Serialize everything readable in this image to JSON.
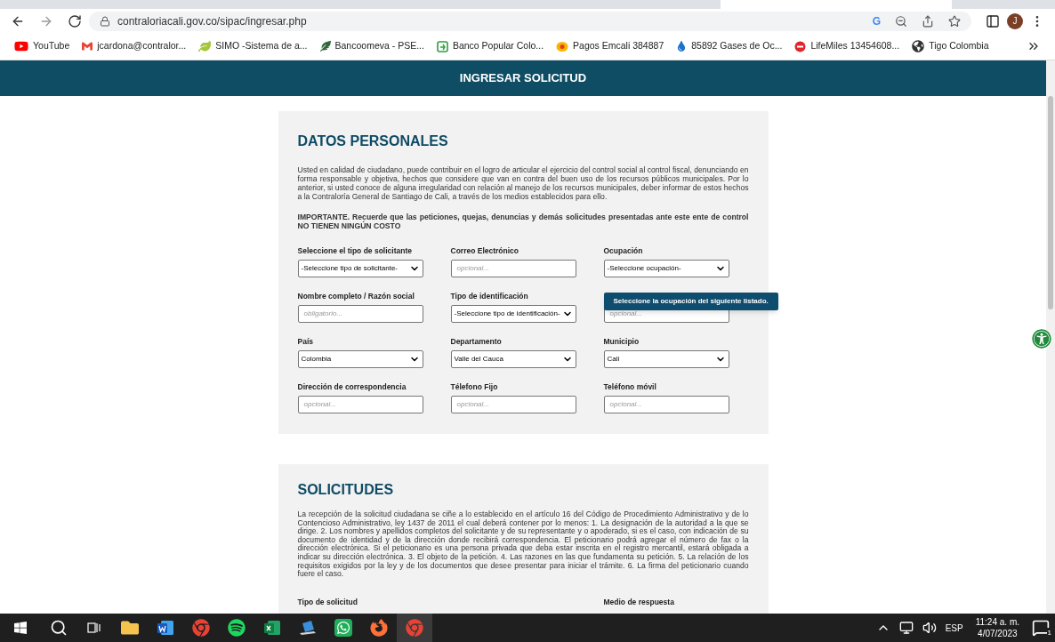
{
  "browser": {
    "url": "contraloriacali.gov.co/sipac/ingresar.php",
    "address_bar_badge": "G",
    "profile_initial": "J",
    "bookmarks": [
      {
        "label": "YouTube",
        "kind": "play"
      },
      {
        "label": "jcardona@contralor...",
        "kind": "mail"
      },
      {
        "label": "SIMO -Sistema de a...",
        "kind": "leaf"
      },
      {
        "label": "Bancoomeva - PSE...",
        "kind": "feather"
      },
      {
        "label": "Banco Popular Colo...",
        "kind": "bank"
      },
      {
        "label": "Pagos Emcali 384887",
        "kind": "burst"
      },
      {
        "label": "85892 Gases de Oc...",
        "kind": "drop"
      },
      {
        "label": "LifeMiles 13454608...",
        "kind": "lm"
      },
      {
        "label": "Tigo Colombia",
        "kind": "globe"
      }
    ]
  },
  "header": {
    "title": "INGRESAR SOLICITUD"
  },
  "datos_personales": {
    "title": "DATOS PERSONALES",
    "intro": "Usted en calidad de ciudadano, puede contribuir en el logro de articular el ejercicio del control social al control fiscal, denunciando en forma responsable y objetiva, hechos que considere que van en contra del buen uso de los recursos públicos municipales. Por lo anterior, si usted conoce de alguna irregularidad con relación al manejo de los recursos municipales, deber informar de estos hechos a la Contraloría General de Santiago de Cali, a través de los medios establecidos para ello.",
    "important": "IMPORTANTE. Recuerde que las peticiones, quejas, denuncias y demás solicitudes presentadas ante este ente de control NO TIENEN NINGÚN COSTO",
    "fields": [
      {
        "kind": "select",
        "label": "Seleccione el tipo de solicitante",
        "value": "-Seleccione tipo de solicitante-"
      },
      {
        "kind": "input",
        "label": "Correo Electrónico",
        "placeholder": "opcional..."
      },
      {
        "kind": "select",
        "label": "Ocupación",
        "value": "-Seleccione ocupación-",
        "tooltip": "Seleccione la ocupación del siguiente listado."
      },
      {
        "kind": "input",
        "label": "Nombre completo / Razón social",
        "placeholder": "obligatorio..."
      },
      {
        "kind": "select",
        "label": "Tipo de identificación",
        "value": "-Seleccione tipo de identificación-"
      },
      {
        "kind": "input",
        "placeholder": "opcional..."
      },
      {
        "kind": "select",
        "label": "País",
        "value": "Colombia"
      },
      {
        "kind": "select",
        "label": "Departamento",
        "value": "Valle del Cauca"
      },
      {
        "kind": "select",
        "label": "Municipio",
        "value": "Cali"
      },
      {
        "kind": "input",
        "label": "Dirección de correspondencia",
        "placeholder": "opcional..."
      },
      {
        "kind": "input",
        "label": "Télefono Fijo",
        "placeholder": "opcional..."
      },
      {
        "kind": "input",
        "label": "Teléfono móvil",
        "placeholder": "opcional..."
      }
    ]
  },
  "solicitudes": {
    "title": "SOLICITUDES",
    "text": "La recepción de la solicitud ciudadana se ciñe a lo establecido en el artículo 16 del Código de Procedimiento Administrativo y de lo Contencioso Administrativo, ley 1437 de 2011 el cual deberá contener por lo menos: 1. La designación de la autoridad a la que se dirige. 2. Los nombres y apellidos completos del solicitante y de su representante y o apoderado, si es el caso, con indicación de su documento de identidad y de la dirección donde recibirá correspondencia. El peticionario podrá agregar el número de fax o la dirección electrónica. Si el peticionario es una persona privada que deba estar inscrita en el registro mercantil, estará obligada a indicar su dirección electrónica. 3. El objeto de la petición. 4. Las razones en las que fundamenta su petición. 5. La relación de los requisitos exigidos por la ley y de los documentos que desee presentar para iniciar el trámite. 6. La firma del peticionario cuando fuere el caso.",
    "labels": [
      {
        "label": "Tipo de solicitud"
      },
      {
        "label": "Medio de respuesta"
      }
    ]
  },
  "taskbar": {
    "apps": [
      {
        "kind": "folder",
        "active": false
      },
      {
        "kind": "word",
        "active": false
      },
      {
        "kind": "chrome",
        "active": false
      },
      {
        "kind": "spotify",
        "active": false
      },
      {
        "kind": "excel",
        "active": false
      },
      {
        "kind": "vpn",
        "active": false
      },
      {
        "kind": "whatsapp",
        "active": false
      },
      {
        "kind": "firefox",
        "active": false
      },
      {
        "kind": "chrome",
        "active": true
      }
    ],
    "language": "ESP",
    "time": "11:24 a. m.",
    "date": "4/07/2023",
    "notifications": "1"
  }
}
